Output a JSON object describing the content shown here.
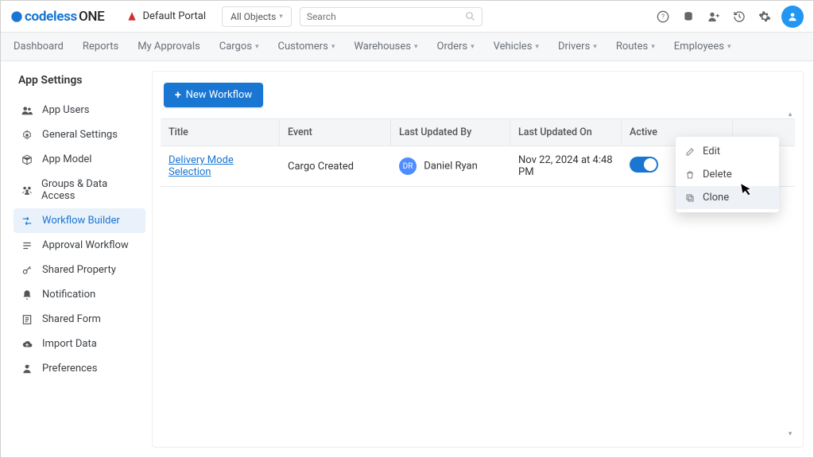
{
  "header": {
    "logo_blue": "codeless",
    "logo_rest": "ONE",
    "home_icon": "home",
    "portal_name": "Default Portal",
    "object_selector": "All Objects",
    "search_placeholder": "Search",
    "top_icons": [
      "help-icon",
      "db-icon",
      "add-user-icon",
      "history-icon",
      "gear-icon",
      "profile-icon"
    ]
  },
  "nav": {
    "items": [
      "Dashboard",
      "Reports",
      "My Approvals",
      "Cargos",
      "Customers",
      "Warehouses",
      "Orders",
      "Vehicles",
      "Drivers",
      "Routes",
      "Employees"
    ],
    "has_dropdown": [
      false,
      false,
      false,
      true,
      true,
      true,
      true,
      true,
      true,
      true,
      true
    ]
  },
  "sidebar": {
    "title": "App Settings",
    "items": [
      {
        "icon": "users",
        "label": "App Users"
      },
      {
        "icon": "gear",
        "label": "General Settings"
      },
      {
        "icon": "cube",
        "label": "App Model"
      },
      {
        "icon": "group",
        "label": "Groups & Data Access"
      },
      {
        "icon": "flow",
        "label": "Workflow Builder",
        "active": true
      },
      {
        "icon": "list",
        "label": "Approval Workflow"
      },
      {
        "icon": "key",
        "label": "Shared Property"
      },
      {
        "icon": "bell",
        "label": "Notification"
      },
      {
        "icon": "form",
        "label": "Shared Form"
      },
      {
        "icon": "cloud",
        "label": "Import Data"
      },
      {
        "icon": "pref",
        "label": "Preferences"
      }
    ]
  },
  "main": {
    "new_button": "New Workflow",
    "columns": [
      "Title",
      "Event",
      "Last Updated By",
      "Last Updated On",
      "Active",
      ""
    ],
    "rows": [
      {
        "title": "Delivery Mode Selection",
        "event": "Cargo Created",
        "user_initials": "DR",
        "user_name": "Daniel Ryan",
        "updated": "Nov 22, 2024 at 4:48 PM",
        "active": true
      }
    ],
    "context_menu": [
      {
        "icon": "edit",
        "label": "Edit"
      },
      {
        "icon": "delete",
        "label": "Delete"
      },
      {
        "icon": "clone",
        "label": "Clone",
        "hover": true
      }
    ]
  }
}
